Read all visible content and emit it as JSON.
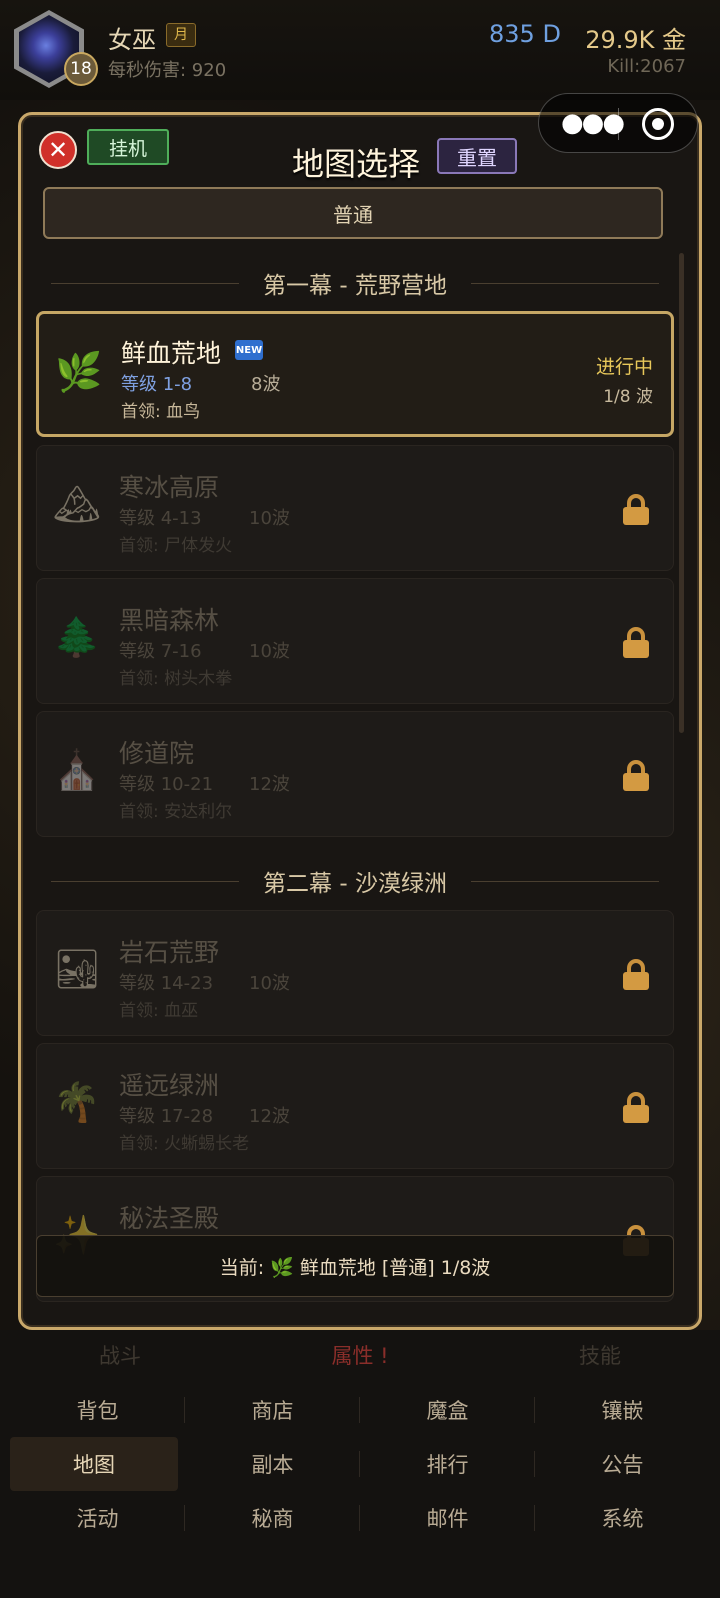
{
  "player": {
    "name": "女巫",
    "title_tag": "月",
    "level": "18",
    "dps": "每秒伤害: 920",
    "diamonds": "835 D",
    "gold": "29.9K 金",
    "kills": "Kill:2067"
  },
  "modal": {
    "title": "地图选择",
    "afk_label": "挂机",
    "reset_label": "重置",
    "difficulty": "普通",
    "current": "当前: 🌿 鲜血荒地 [普通] 1/8波"
  },
  "acts": [
    {
      "header": "第一幕 - 荒野营地",
      "maps": [
        {
          "icon": "🌿",
          "icon_name": "herb-icon",
          "name": "鲜血荒地",
          "new": "NEW",
          "level": "等级 1-8",
          "waves": "8波",
          "boss": "首领: 血鸟",
          "status": "进行中",
          "progress": "1/8 波"
        },
        {
          "icon": "🏔",
          "icon_name": "mountain-icon",
          "name": "寒冰高原",
          "level": "等级 4-13",
          "waves": "10波",
          "boss": "首领: 尸体发火"
        },
        {
          "icon": "🌲",
          "icon_name": "tree-icon",
          "name": "黑暗森林",
          "level": "等级 7-16",
          "waves": "10波",
          "boss": "首领: 树头木拳"
        },
        {
          "icon": "⛪",
          "icon_name": "church-icon",
          "name": "修道院",
          "level": "等级 10-21",
          "waves": "12波",
          "boss": "首领: 安达利尔"
        }
      ]
    },
    {
      "header": "第二幕 - 沙漠绿洲",
      "maps": [
        {
          "icon": "🏜",
          "icon_name": "desert-icon",
          "name": "岩石荒野",
          "level": "等级 14-23",
          "waves": "10波",
          "boss": "首领: 血巫"
        },
        {
          "icon": "🌴",
          "icon_name": "palm-icon",
          "name": "遥远绿洲",
          "level": "等级 17-28",
          "waves": "12波",
          "boss": "首领: 火蜥蜴长老"
        },
        {
          "icon": "✨",
          "icon_name": "sparkle-icon",
          "name": "秘法圣殿",
          "level": "",
          "waves": "",
          "boss": ""
        }
      ]
    }
  ],
  "nav": {
    "tabs": [
      "战斗",
      "属性 !",
      "技能"
    ],
    "grid": [
      [
        "背包",
        "商店",
        "魔盒",
        "镶嵌"
      ],
      [
        "地图",
        "副本",
        "排行",
        "公告"
      ],
      [
        "活动",
        "秘商",
        "邮件",
        "系统"
      ]
    ],
    "selected": "地图"
  }
}
